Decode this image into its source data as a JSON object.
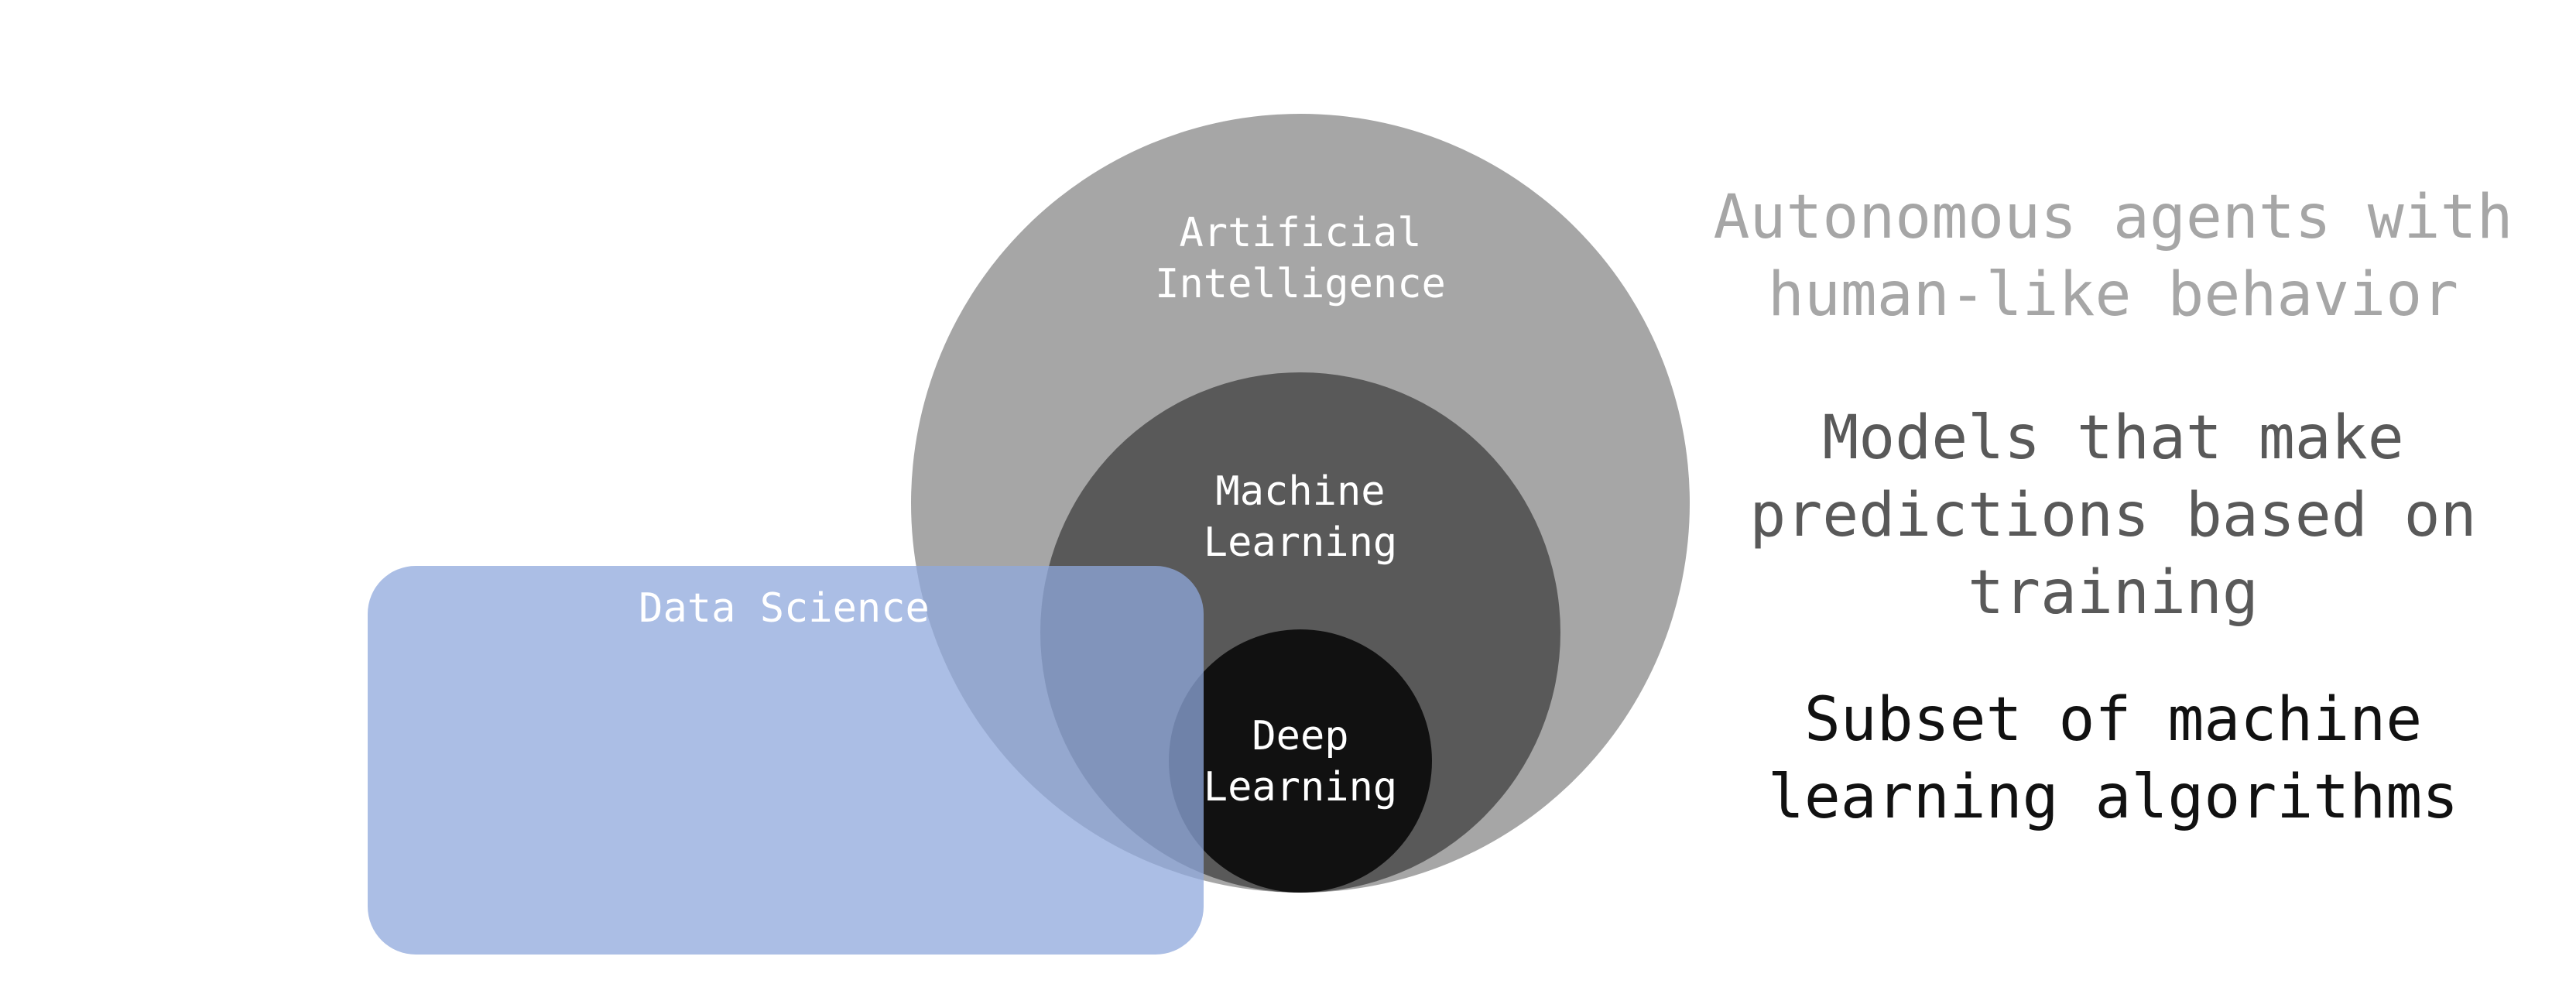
{
  "diagram": {
    "regions": {
      "artificial_intelligence": {
        "label_line1": "Artificial",
        "label_line2": "Intelligence",
        "fill": "#a6a6a6"
      },
      "machine_learning": {
        "label_line1": "Machine",
        "label_line2": "Learning",
        "fill": "#595959"
      },
      "deep_learning": {
        "label_line1": "Deep",
        "label_line2": "Learning",
        "fill": "#111111"
      },
      "data_science": {
        "label": "Data Science",
        "fill": "#8fa8dc",
        "opacity": 0.75
      }
    },
    "label_color": "#ffffff"
  },
  "descriptions": {
    "artificial_intelligence": {
      "text": "Autonomous agents with\nhuman-like behavior",
      "color": "#a6a6a6"
    },
    "machine_learning": {
      "text": "Models that make\npredictions based on\ntraining",
      "color": "#595959"
    },
    "deep_learning": {
      "text": "Subset of machine\nlearning algorithms",
      "color": "#111111"
    }
  }
}
